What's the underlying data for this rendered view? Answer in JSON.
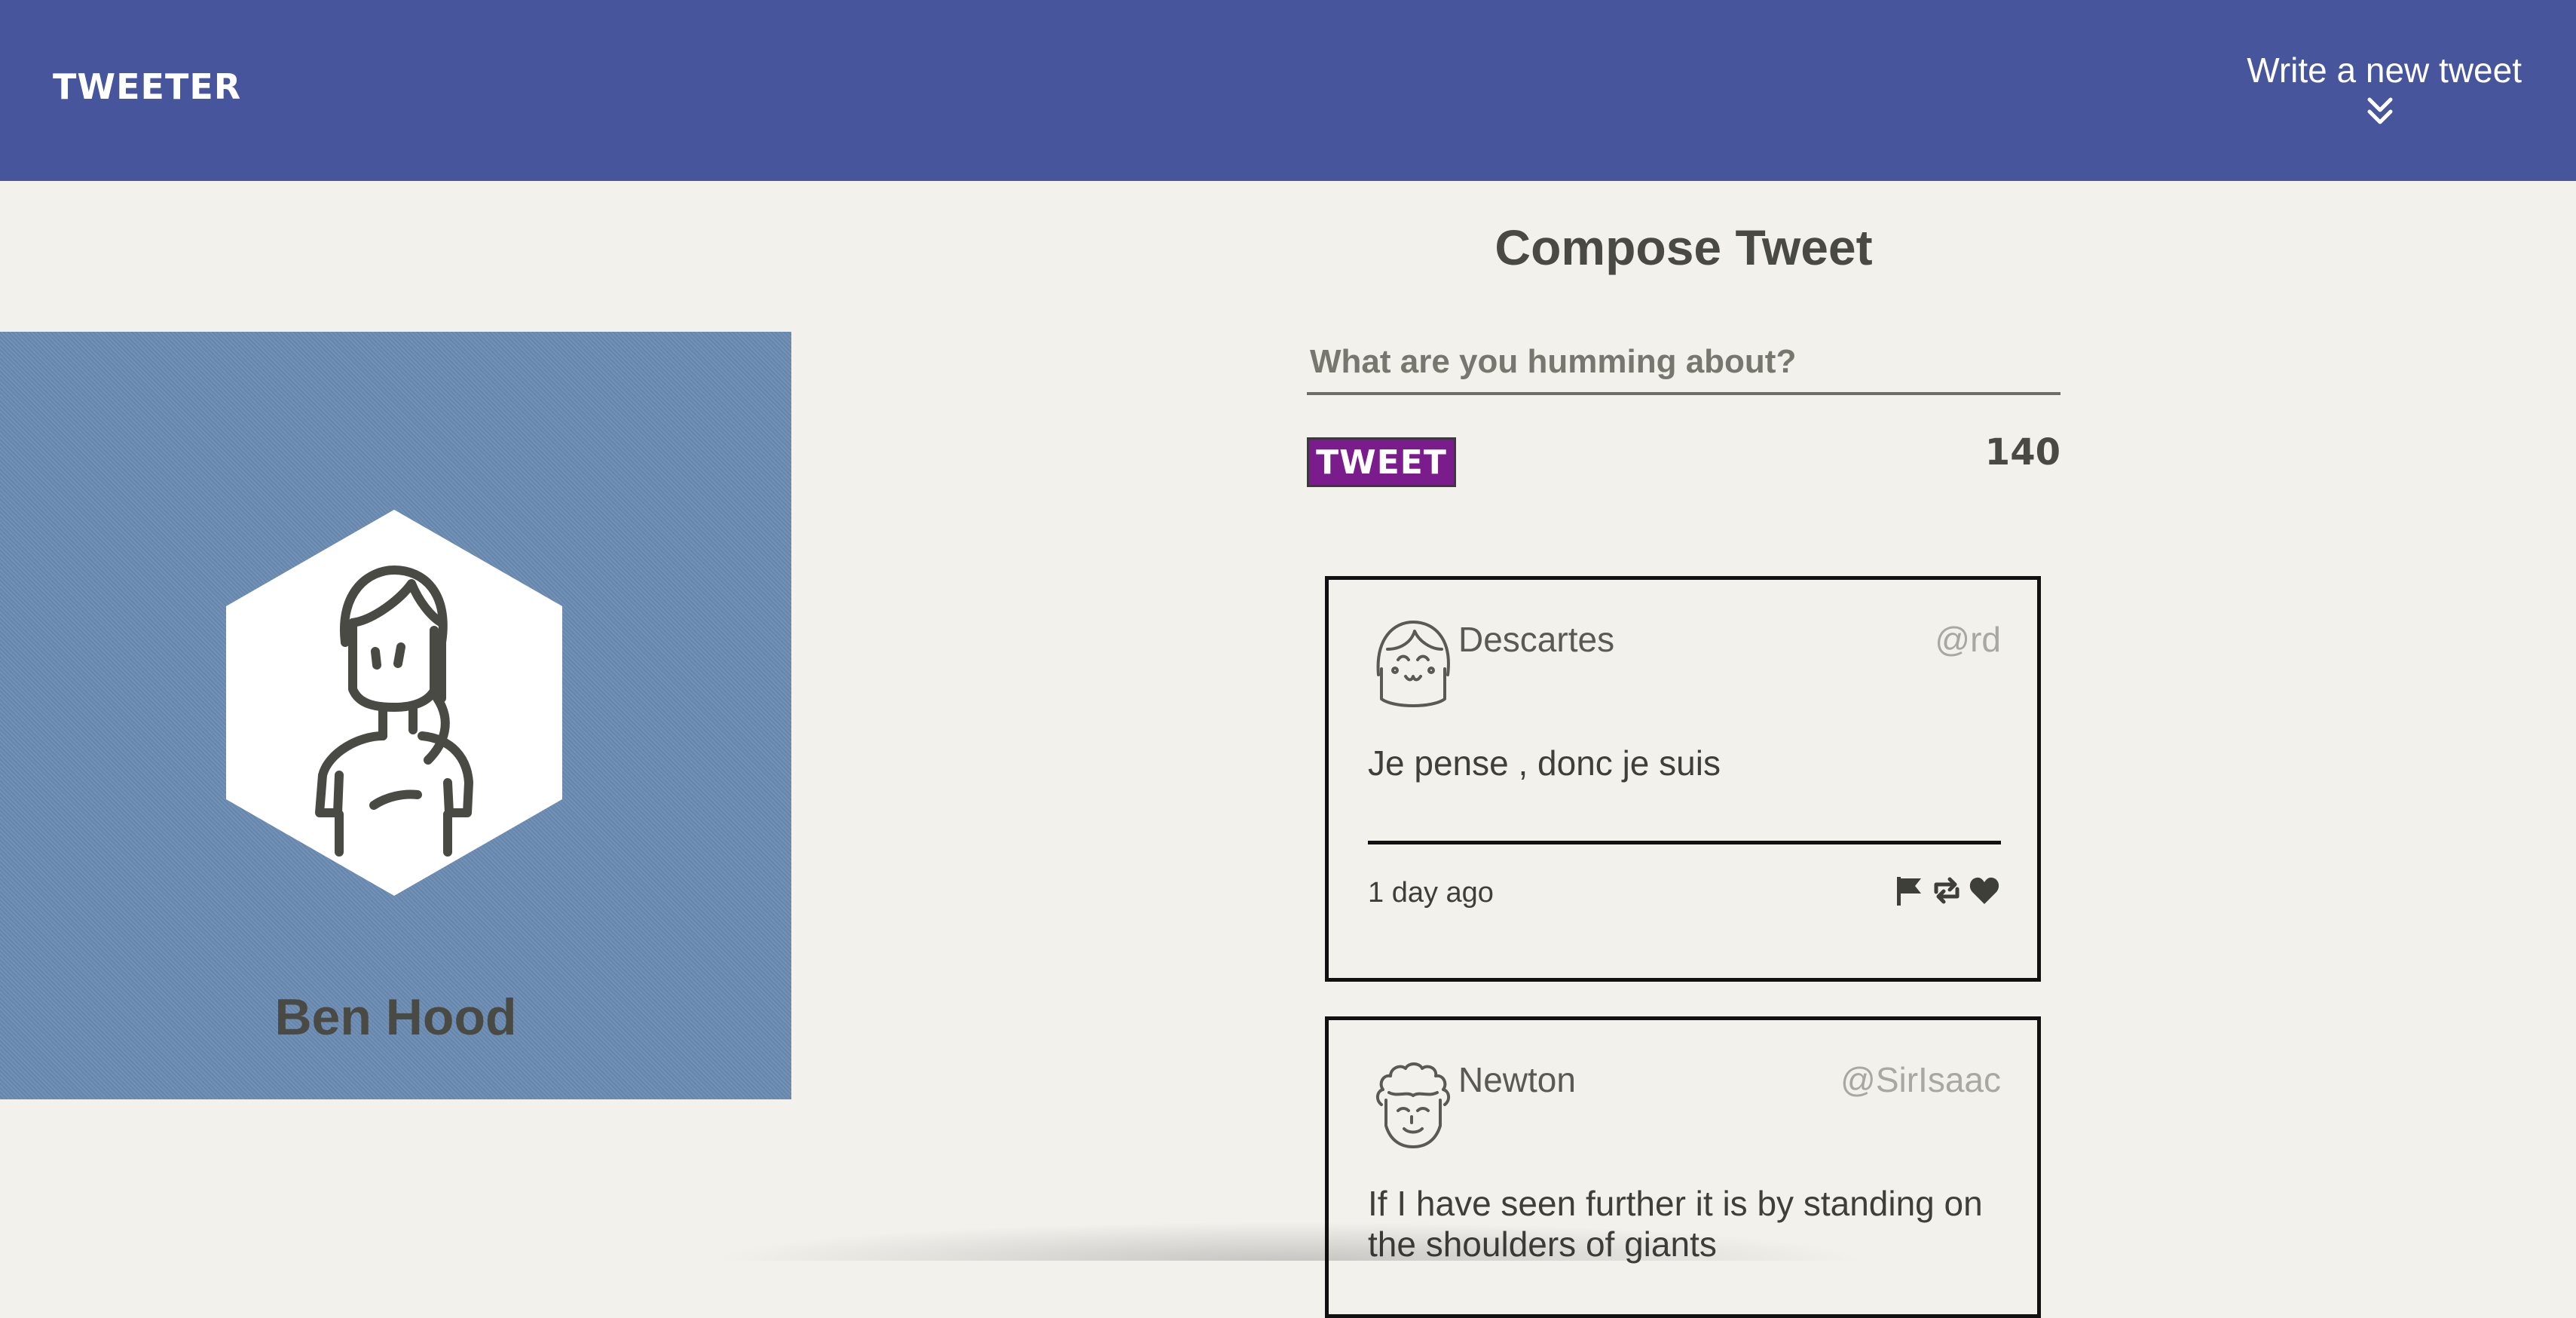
{
  "nav": {
    "logo": "TWEETER",
    "compose_toggle_label": "Write a new tweet",
    "background": "#46559c",
    "toggle_icon": "double-chevron-down-icon"
  },
  "profile": {
    "name": "Ben Hood",
    "background": "#6b8bb2",
    "avatar_icon": "woman-avatar-icon"
  },
  "compose": {
    "title": "Compose Tweet",
    "placeholder": "What are you humming about?",
    "button_label": "TWEET",
    "counter": "140",
    "button_color": "#7a1c8c"
  },
  "tweets": [
    {
      "author": "Descartes",
      "handle": "@rd",
      "content": "Je pense , donc je suis",
      "time": "1 day ago",
      "avatar_icon": "girl-avatar-icon",
      "actions": [
        "flag-icon",
        "retweet-icon",
        "heart-icon"
      ]
    },
    {
      "author": "Newton",
      "handle": "@SirIsaac",
      "content": "If I have seen further it is by standing on the shoulders of giants",
      "avatar_icon": "curly-hair-avatar-icon"
    }
  ]
}
